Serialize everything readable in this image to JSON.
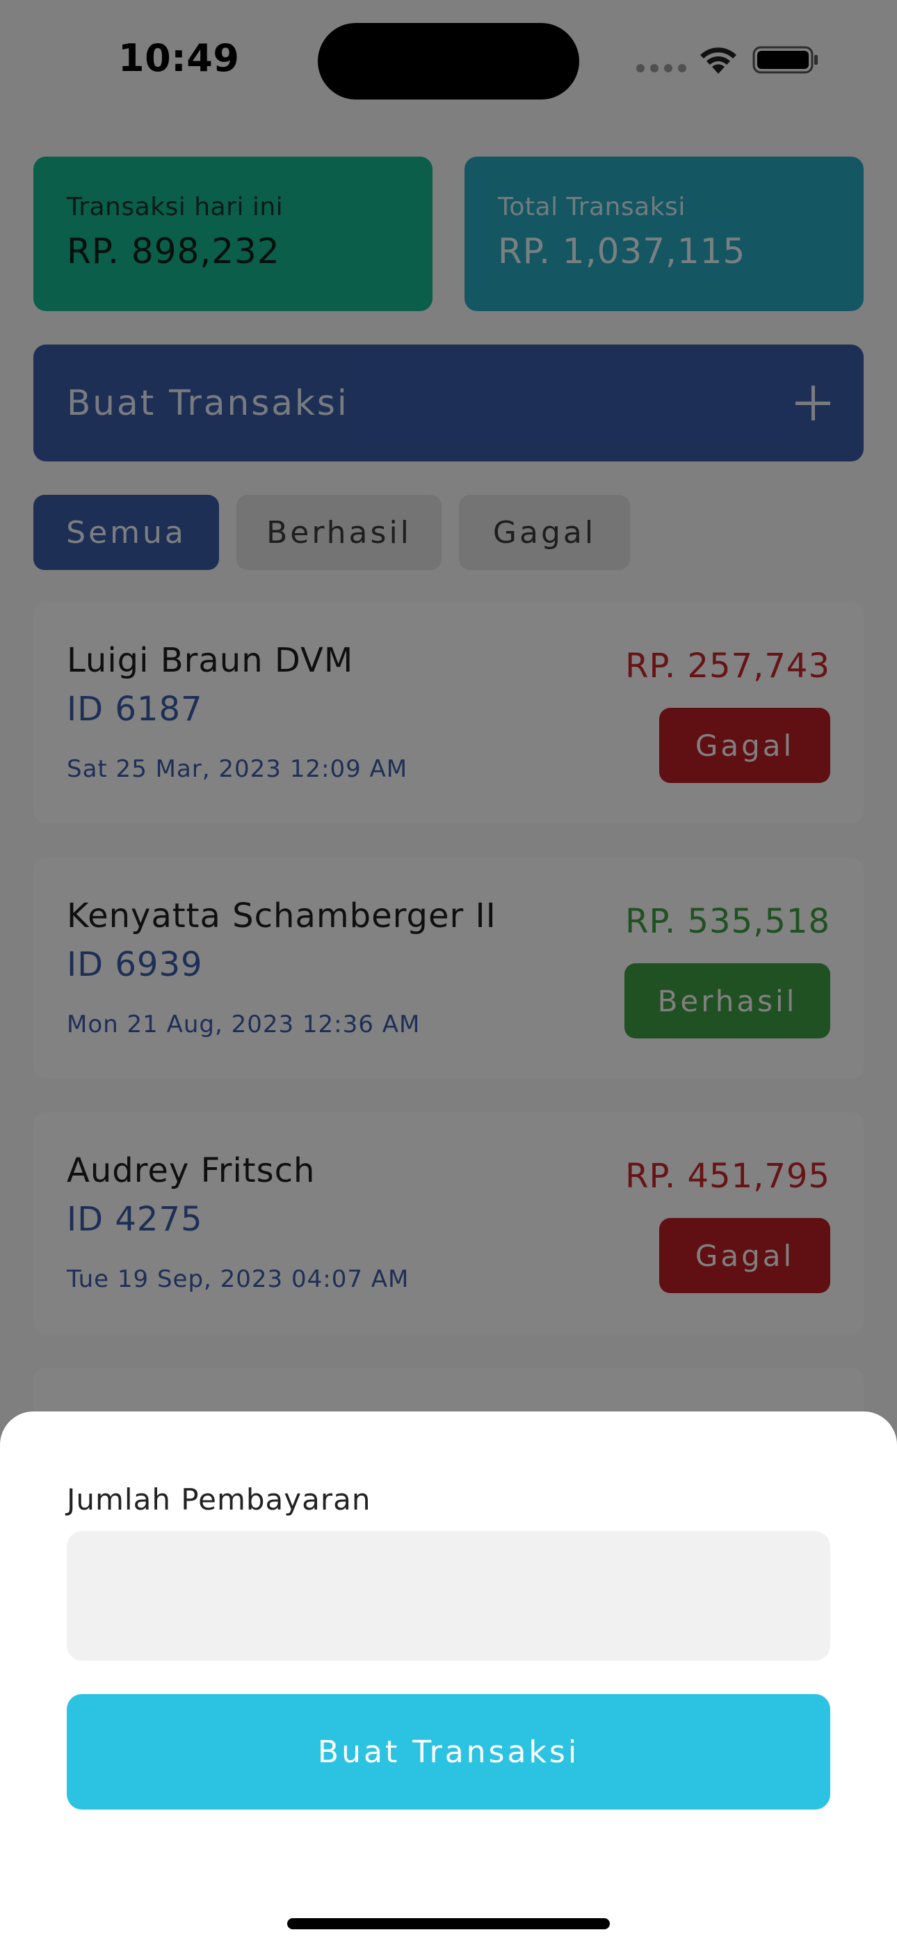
{
  "status_bar": {
    "time": "10:49"
  },
  "summary": {
    "today_label": "Transaksi hari ini",
    "today_value": "RP. 898,232",
    "total_label": "Total Transaksi",
    "total_value": "RP. 1,037,115"
  },
  "create_bar": {
    "label": "Buat Transaksi",
    "icon": "plus-icon"
  },
  "tabs": [
    {
      "label": "Semua",
      "selected": true
    },
    {
      "label": "Berhasil",
      "selected": false
    },
    {
      "label": "Gagal",
      "selected": false
    }
  ],
  "transactions": [
    {
      "name": "Luigi Braun DVM",
      "id": "ID 6187",
      "date": "Sat 25 Mar, 2023 12:09 AM",
      "amount": "RP. 257,743",
      "status": "Gagal"
    },
    {
      "name": "Kenyatta Schamberger II",
      "id": "ID 6939",
      "date": "Mon 21 Aug, 2023 12:36 AM",
      "amount": "RP. 535,518",
      "status": "Berhasil"
    },
    {
      "name": "Audrey Fritsch",
      "id": "ID 4275",
      "date": "Tue 19 Sep, 2023 04:07 AM",
      "amount": "RP. 451,795",
      "status": "Gagal"
    }
  ],
  "sheet": {
    "label": "Jumlah Pembayaran",
    "input_value": "",
    "button_label": "Buat Transaksi"
  },
  "colors": {
    "primary": "#3a5ba6",
    "success": "#3f9b41",
    "failure": "#b81d24",
    "accent": "#2cc3e3"
  }
}
